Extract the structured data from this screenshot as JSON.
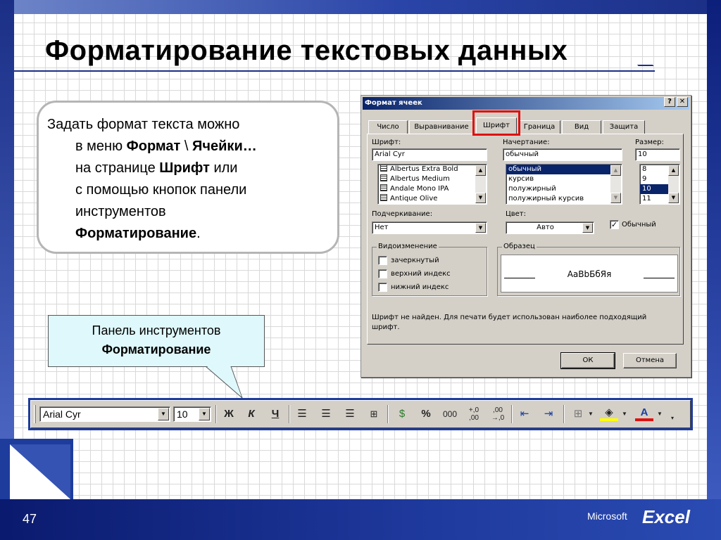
{
  "slide": {
    "title": "Форматирование текстовых данных",
    "page_number": "47",
    "brand_company": "Microsoft",
    "brand_product": "Excel"
  },
  "textbox": {
    "line1": "Задать формат текста можно",
    "line2_pre": "в меню ",
    "line2_bold1": "Формат",
    "line2_mid": " \\ ",
    "line2_bold2": "Ячейки…",
    "line3_pre": "на странице ",
    "line3_bold": "Шрифт",
    "line3_post": " или",
    "line4": "с помощью кнопок панели",
    "line5": "инструментов",
    "line6_bold": "Форматирование",
    "line6_post": "."
  },
  "callout": {
    "line1": "Панель инструментов",
    "line2": "Форматирование"
  },
  "dialog": {
    "title": "Формат ячеек",
    "help_label": "?",
    "close_label": "✕",
    "tabs": [
      "Число",
      "Выравнивание",
      "Шрифт",
      "Граница",
      "Вид",
      "Защита"
    ],
    "active_tab": "Шрифт",
    "font_label": "Шрифт:",
    "font_value": "Arial Cyr",
    "font_list": [
      "Albertus Extra Bold",
      "Albertus Medium",
      "Andale Mono IPA",
      "Antique Olive"
    ],
    "style_label": "Начертание:",
    "style_value": "обычный",
    "style_list": [
      "обычный",
      "курсив",
      "полужирный",
      "полужирный курсив"
    ],
    "style_selected": "обычный",
    "size_label": "Размер:",
    "size_value": "10",
    "size_list": [
      "8",
      "9",
      "10",
      "11"
    ],
    "size_selected": "10",
    "underline_label": "Подчеркивание:",
    "underline_value": "Нет",
    "color_label": "Цвет:",
    "color_value": "Авто",
    "normal_font_label": "Обычный",
    "effects_title": "Видоизменение",
    "effects": [
      "зачеркнутый",
      "верхний индекс",
      "нижний индекс"
    ],
    "sample_title": "Образец",
    "sample_text": "AaBbБбЯя",
    "note": "Шрифт не найден. Для печати будет использован наиболее подходящий шрифт.",
    "ok_label": "ОК",
    "cancel_label": "Отмена"
  },
  "toolbar": {
    "font_value": "Arial Cyr",
    "size_value": "10",
    "bold": "Ж",
    "italic": "К",
    "underline": "Ч",
    "percent": "%",
    "thousands": "000",
    "inc_decimal": "+,0\n,00",
    "dec_decimal": ",00\n→,0"
  },
  "colors": {
    "accent_blue": "#1e3c9c",
    "highlight_red": "#e01010",
    "callout_fill": "#dff8fb",
    "title_bar": "#0a246a"
  }
}
